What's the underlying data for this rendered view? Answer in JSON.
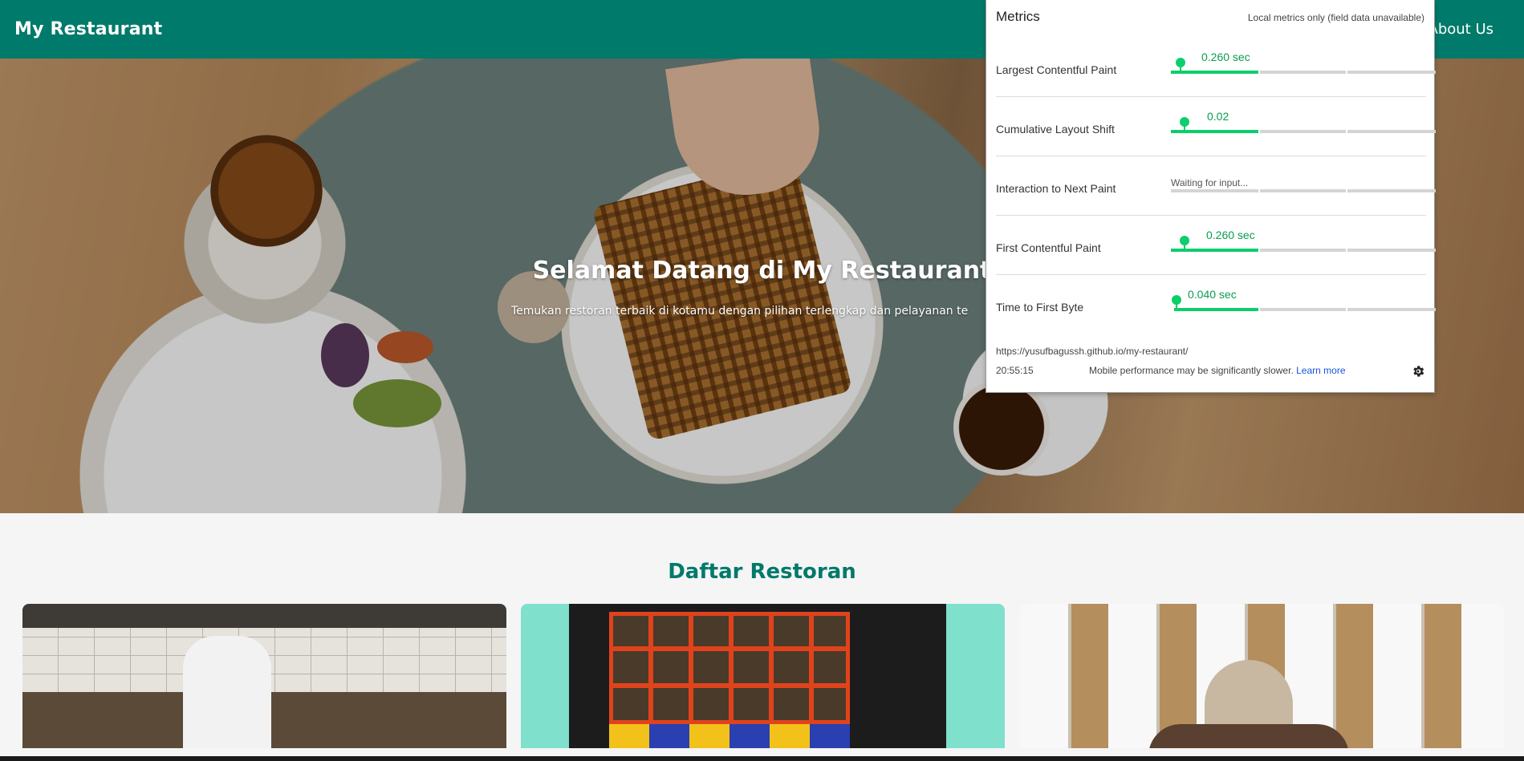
{
  "header": {
    "brand": "My Restaurant",
    "nav": {
      "about": "About Us"
    }
  },
  "hero": {
    "title": "Selamat Datang di My Restaurant",
    "subtitle": "Temukan restoran terbaik di kotamu dengan pilihan terlengkap dan pelayanan te"
  },
  "restaurants": {
    "title": "Daftar Restoran"
  },
  "metrics": {
    "title": "Metrics",
    "note": "Local metrics only (field data unavailable)",
    "items": [
      {
        "label": "Largest Contentful Paint",
        "value": "0.260 sec",
        "status": "good"
      },
      {
        "label": "Cumulative Layout Shift",
        "value": "0.02",
        "status": "good"
      },
      {
        "label": "Interaction to Next Paint",
        "value": "Waiting for input...",
        "status": "waiting"
      },
      {
        "label": "First Contentful Paint",
        "value": "0.260 sec",
        "status": "good"
      },
      {
        "label": "Time to First Byte",
        "value": "0.040 sec",
        "status": "good"
      }
    ],
    "url": "https://yusufbagussh.github.io/my-restaurant/",
    "time": "20:55:15",
    "warning": "Mobile performance may be significantly slower.",
    "learn_more": "Learn more",
    "colors": {
      "good": "#0cce6b",
      "header": "#007a6a"
    }
  }
}
